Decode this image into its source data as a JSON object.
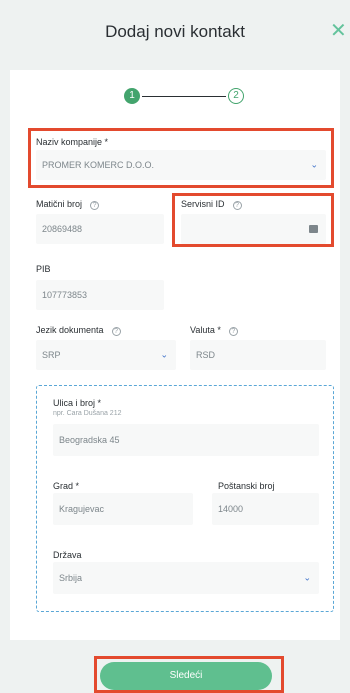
{
  "header": {
    "title": "Dodaj novi kontakt",
    "close_icon": "close-icon"
  },
  "stepper": {
    "step1": "1",
    "step2": "2"
  },
  "company": {
    "label": "Naziv kompanije *",
    "value": "PROMER KOMERC D.O.O."
  },
  "maticni": {
    "label": "Matični broj",
    "value": "20869488"
  },
  "servisni": {
    "label": "Servisni ID",
    "value": ""
  },
  "pib": {
    "label": "PIB",
    "value": "107773853"
  },
  "jezik": {
    "label": "Jezik dokumenta",
    "value": "SRP"
  },
  "valuta": {
    "label": "Valuta *",
    "value": "RSD"
  },
  "address": {
    "street_label": "Ulica i broj *",
    "street_hint": "npr. Cara Dušana 212",
    "street_value": "Beogradska 45",
    "city_label": "Grad *",
    "city_value": "Kragujevac",
    "postal_label": "Poštanski broj",
    "postal_value": "14000",
    "country_label": "Država",
    "country_value": "Srbija"
  },
  "footer": {
    "next_label": "Sledeći"
  },
  "colors": {
    "accent": "#43a46d",
    "highlight": "#e34a2e",
    "button": "#5fbf8f"
  }
}
